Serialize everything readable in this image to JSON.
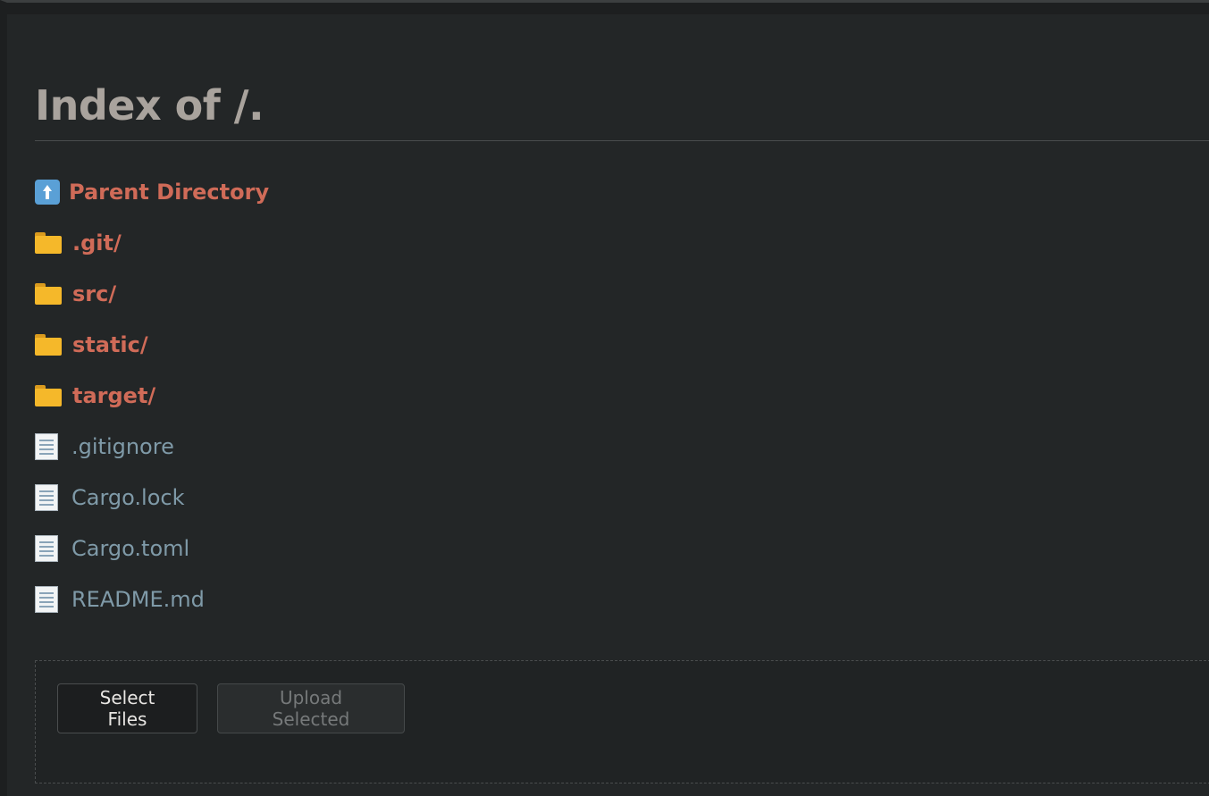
{
  "page": {
    "title": "Index of /."
  },
  "entries": [
    {
      "kind": "parent",
      "icon": "up-arrow-icon",
      "label": "Parent Directory"
    },
    {
      "kind": "dir",
      "icon": "folder-icon",
      "label": ".git/"
    },
    {
      "kind": "dir",
      "icon": "folder-icon",
      "label": "src/"
    },
    {
      "kind": "dir",
      "icon": "folder-icon",
      "label": "static/"
    },
    {
      "kind": "dir",
      "icon": "folder-icon",
      "label": "target/"
    },
    {
      "kind": "file",
      "icon": "file-icon",
      "label": ".gitignore"
    },
    {
      "kind": "file",
      "icon": "file-icon",
      "label": "Cargo.lock"
    },
    {
      "kind": "file",
      "icon": "file-icon",
      "label": "Cargo.toml"
    },
    {
      "kind": "file",
      "icon": "file-icon",
      "label": "README.md"
    }
  ],
  "upload": {
    "select_label": "Select Files",
    "upload_label": "Upload Selected",
    "upload_enabled": false
  },
  "colors": {
    "background": "#232627",
    "heading": "#a9a39d",
    "directory_link": "#d06b58",
    "file_link": "#7f9aa8"
  }
}
